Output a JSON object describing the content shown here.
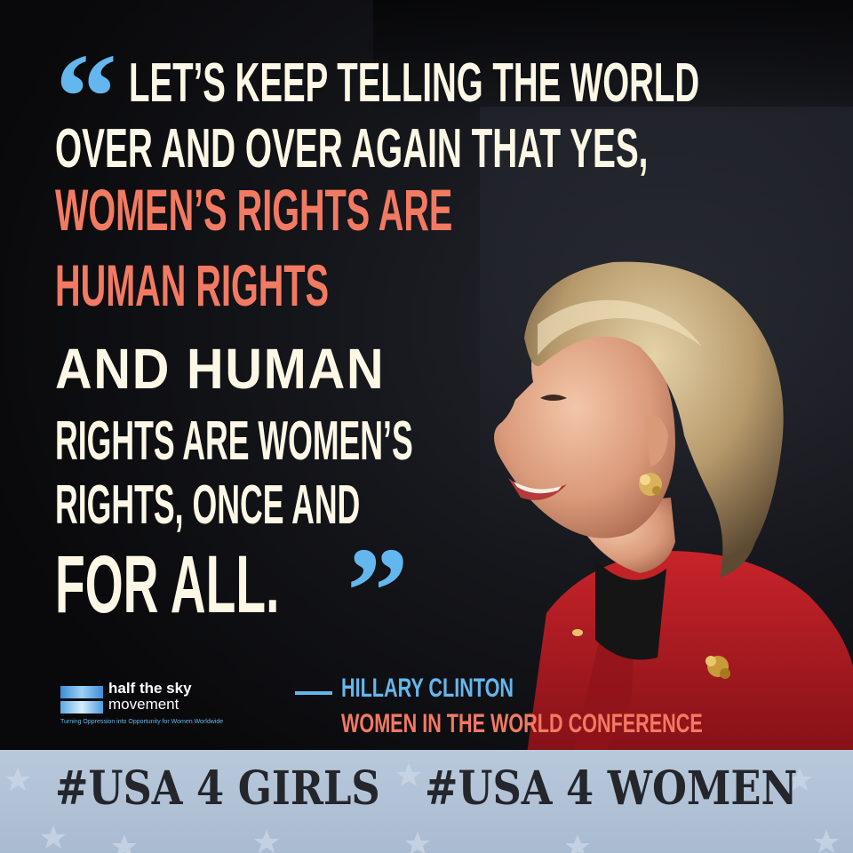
{
  "quote": {
    "open_mark": "“",
    "line1": "LET’S KEEP TELLING THE WORLD",
    "line2": "OVER AND OVER AGAIN THAT YES,",
    "line3": "WOMEN’S RIGHTS ARE",
    "line4": "HUMAN RIGHTS",
    "line5": "AND HUMAN",
    "line6": "RIGHTS ARE WOMEN’S",
    "line7": "RIGHTS, ONCE AND",
    "line8": "FOR ALL.",
    "close_mark": "”"
  },
  "attribution": {
    "name": "HILLARY CLINTON",
    "event": "WOMEN IN THE WORLD CONFERENCE"
  },
  "logo": {
    "name": "half the sky",
    "subname": "movement",
    "tagline": "Turning Oppression into Opportunity for Women Worldwide"
  },
  "hashtags": [
    "#USA 4 GIRLS",
    "#USA 4 WOMEN"
  ],
  "colors": {
    "cream": "#fdf8e6",
    "salmon": "#f37a62",
    "sky_blue": "#63b7ee",
    "background": "#0b0b0d",
    "band": "#b9c9dc"
  },
  "icons": [
    "half-the-sky-logo-icon",
    "star-pattern-icon"
  ]
}
